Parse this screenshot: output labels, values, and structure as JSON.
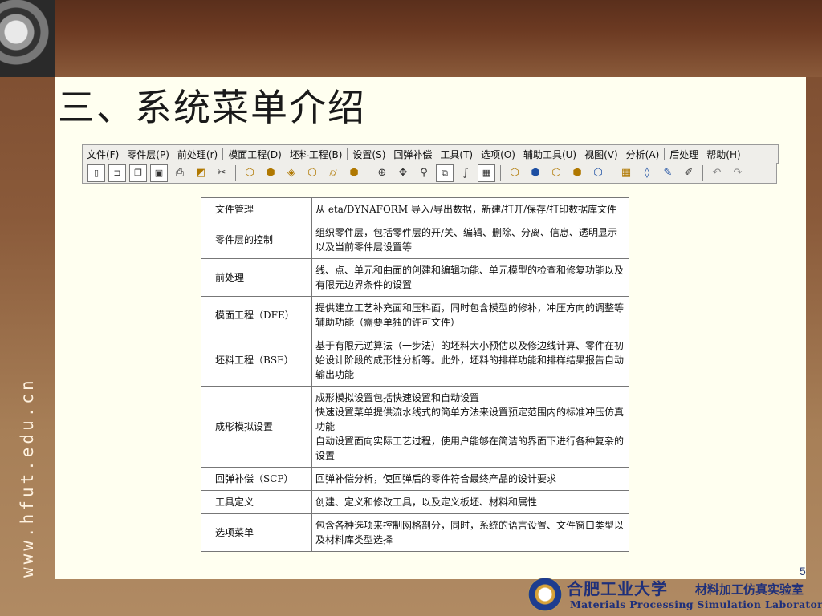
{
  "slide": {
    "title": "三、系统菜单介绍",
    "page_number": "5",
    "side_url": "www.hfut.edu.cn"
  },
  "menubar": {
    "items": [
      "文件(F)",
      "零件层(P)",
      "前处理(r)",
      "模面工程(D)",
      "坯料工程(B)",
      "设置(S)",
      "回弹补偿",
      "工具(T)",
      "选项(O)",
      "辅助工具(U)",
      "视图(V)",
      "分析(A)",
      "后处理",
      "帮助(H)"
    ]
  },
  "toolbar": {
    "icons": [
      "new-file-icon",
      "open-folder-icon",
      "copy-icon",
      "save-icon",
      "print-icon",
      "layer-edit-icon",
      "scissors-curve-icon",
      "cube-icon-1",
      "cube-icon-2",
      "cube-icon-3",
      "cube-icon-4",
      "cylinder-icon",
      "cube-icon-5",
      "sphere-rotate-icon",
      "pan-icon",
      "zoom-icon",
      "zoom-window-icon",
      "curve-tool-icon",
      "grid-icon",
      "part-icon-1",
      "part-icon-2",
      "part-icon-3",
      "part-icon-4",
      "part-icon-5",
      "mesh-icon",
      "surface-icon",
      "brush-icon",
      "wand-icon",
      "undo-icon",
      "redo-icon"
    ]
  },
  "table": {
    "rows": [
      {
        "key": "文件管理",
        "value": "从 eta/DYNAFORM 导入/导出数据，新建/打开/保存/打印数据库文件"
      },
      {
        "key": "零件层的控制",
        "value": "组织零件层，包括零件层的开/关、编辑、删除、分离、信息、透明显示以及当前零件层设置等"
      },
      {
        "key": "前处理",
        "value": "线、点、单元和曲面的创建和编辑功能、单元模型的检查和修复功能以及有限元边界条件的设置"
      },
      {
        "key": "模面工程（DFE）",
        "value": "提供建立工艺补充面和压料面，同时包含模型的修补，冲压方向的调整等辅助功能（需要单独的许可文件）"
      },
      {
        "key": "坯料工程（BSE）",
        "value": "基于有限元逆算法（一步法）的坯料大小预估以及修边线计算、零件在初始设计阶段的成形性分析等。此外，坯料的排样功能和排样结果报告自动输出功能"
      },
      {
        "key": "成形模拟设置",
        "value": "成形模拟设置包括快速设置和自动设置\n快速设置菜单提供流水线式的简单方法来设置预定范围内的标准冲压仿真功能\n自动设置面向实际工艺过程，使用户能够在简洁的界面下进行各种复杂的设置"
      },
      {
        "key": "回弹补偿（SCP）",
        "value": "回弹补偿分析，使回弹后的零件符合最终产品的设计要求"
      },
      {
        "key": "工具定义",
        "value": "创建、定义和修改工具，以及定义板坯、材料和属性"
      },
      {
        "key": "选项菜单",
        "value": "包含各种选项来控制网格剖分，同时，系统的语言设置、文件窗口类型以及材料库类型选择"
      }
    ]
  },
  "logo": {
    "cn_name": "合肥工业大学",
    "lab_name": "材料加工仿真实验室",
    "en_name": "Materials Processing Simulation Laboratory"
  }
}
